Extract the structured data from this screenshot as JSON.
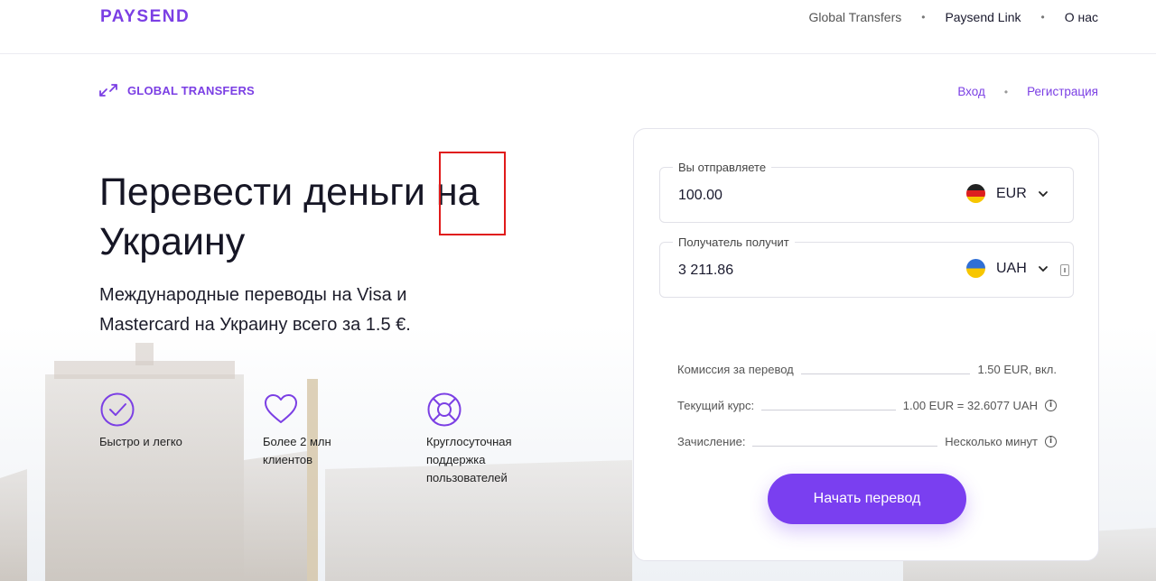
{
  "brand": {
    "logo_text": "PAYSEND",
    "accent_color": "#7b3fe4"
  },
  "topnav": {
    "items": [
      {
        "label": "Global Transfers"
      },
      {
        "label": "Paysend Link"
      },
      {
        "label": "О нас"
      }
    ]
  },
  "subbar": {
    "product_icon": "transfer-arrows-icon",
    "product_label": "GLOBAL TRANSFERS",
    "login_label": "Вход",
    "register_label": "Регистрация"
  },
  "hero": {
    "title_part1": "Перевести деньги ",
    "title_highlight": "на",
    "title_part2": "Украину",
    "subtitle": "Международные переводы на Visa и Mastercard на Украину всего за 1.5 €."
  },
  "features": [
    {
      "icon": "check-circle-icon",
      "label": "Быстро и легко"
    },
    {
      "icon": "heart-icon",
      "label": "Более 2 млн клиентов"
    },
    {
      "icon": "lifebuoy-icon",
      "label": "Круглосуточная поддержка пользователей"
    }
  ],
  "calculator": {
    "send": {
      "label": "Вы отправляете",
      "value": "100.00",
      "currency": "EUR",
      "flag": "germany-flag-icon"
    },
    "receive": {
      "label": "Получатель получит",
      "value": "3 211.86",
      "currency": "UAH",
      "flag": "ukraine-flag-icon"
    },
    "fee": {
      "label": "Комиссия за перевод",
      "value": "1.50 EUR, вкл."
    },
    "rate": {
      "label": "Текущий курс:",
      "value": "1.00 EUR = 32.6077 UAH"
    },
    "delivery": {
      "label": "Зачисление:",
      "value": "Несколько минут"
    },
    "cta_label": "Начать перевод",
    "cta_color": "#7a3ff0"
  }
}
